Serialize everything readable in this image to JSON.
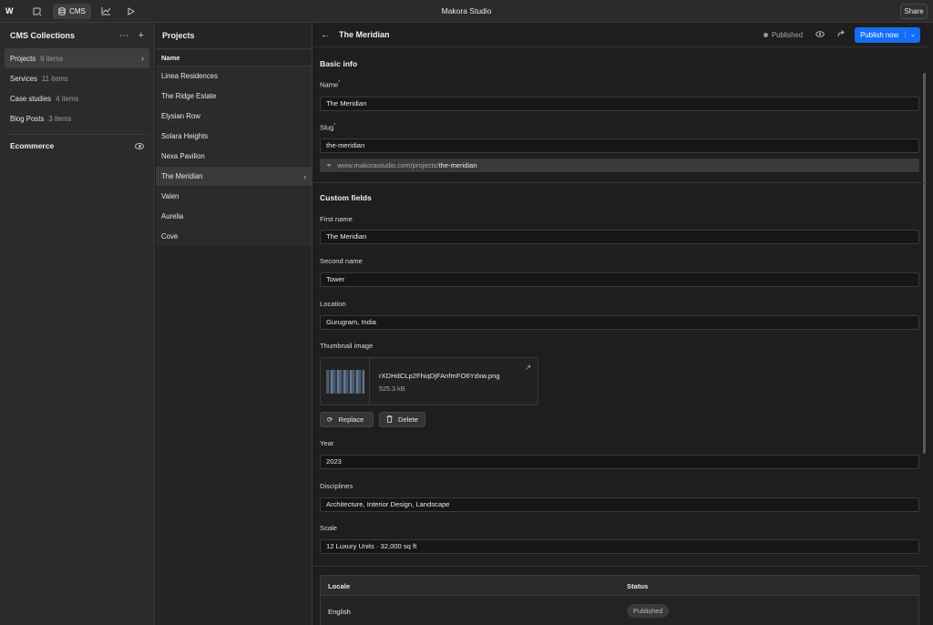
{
  "topbar": {
    "title": "Makora Studio",
    "cms_label": "CMS",
    "share_label": "Share"
  },
  "collections": {
    "heading": "CMS Collections",
    "items": [
      {
        "label": "Projects",
        "count": "9 items"
      },
      {
        "label": "Services",
        "count": "11 items"
      },
      {
        "label": "Case studies",
        "count": "4 items"
      },
      {
        "label": "Blog Posts",
        "count": "3 items"
      }
    ],
    "ecommerce_label": "Ecommerce"
  },
  "projects": {
    "heading": "Projects",
    "column_header": "Name",
    "rows": [
      "Linea Residences",
      "The Ridge Estate",
      "Elysian Row",
      "Solara Heights",
      "Nexa Pavilion",
      "The Meridian",
      "Valen",
      "Aurelia",
      "Cove"
    ]
  },
  "editor": {
    "title": "The Meridian",
    "status": "Published",
    "publish_label": "Publish now",
    "basic_info_heading": "Basic info",
    "name_label": "Name",
    "name_value": "The Meridian",
    "slug_label": "Slug",
    "slug_value": "the-meridian",
    "url_prefix": "www.makorastudio.com/projects/",
    "url_slug": "the-meridian",
    "custom_fields_heading": "Custom fields",
    "first_name_label": "First name",
    "first_name_value": "The Meridian",
    "second_name_label": "Second name",
    "second_name_value": "Tower",
    "location_label": "Location",
    "location_value": "Gurugram, India",
    "thumbnail_label": "Thumbnail image",
    "thumbnail_filename": "rXDHdCLp2FhiqDjFAnfmFO6Ydxw.png",
    "thumbnail_size": "525.3 kB",
    "replace_label": "Replace",
    "delete_label": "Delete",
    "year_label": "Year",
    "year_value": "2023",
    "disciplines_label": "Disciplines",
    "disciplines_value": "Architecture, Interior Design, Landscape",
    "scale_label": "Scale",
    "scale_value": "12 Luxury Units · 32,000 sq ft",
    "locale_header": "Locale",
    "status_header": "Status",
    "locale_row": {
      "locale": "English",
      "status": "Published"
    }
  }
}
